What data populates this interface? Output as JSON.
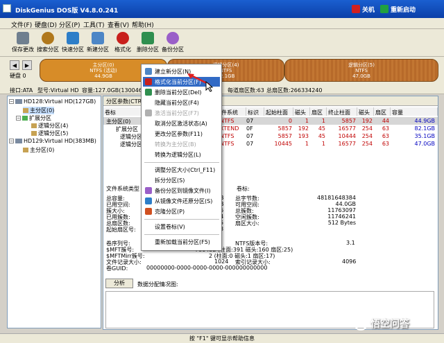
{
  "titlebar": {
    "title": "DiskGenius DOS版 V4.8.0.241",
    "shutdown": "关机",
    "restart": "重新启动"
  },
  "menubar": [
    "文件(F)",
    "硬盘(D)",
    "分区(P)",
    "工具(T)",
    "查看(V)",
    "帮助(H)"
  ],
  "toolbar": [
    {
      "label": "保存更改",
      "icon": "save-icon",
      "color": "#6f7f8f"
    },
    {
      "label": "搜索分区",
      "icon": "search-icon",
      "color": "#b0781c"
    },
    {
      "label": "快速分区",
      "icon": "quick-partition-icon",
      "color": "#2d7ec8"
    },
    {
      "label": "新建分区",
      "icon": "new-partition-icon",
      "color": "#4c86c6"
    },
    {
      "label": "格式化",
      "icon": "format-icon",
      "color": "#c8201c"
    },
    {
      "label": "删除分区",
      "icon": "delete-icon",
      "color": "#2f8f4f"
    },
    {
      "label": "备份分区",
      "icon": "backup-icon",
      "color": "#9a5fc8"
    }
  ],
  "diskbar": {
    "disk_label": "硬盘 0",
    "partitions": [
      {
        "name": "主分区(0)",
        "fs": "NTFS (活动)",
        "size": "44.9GB"
      },
      {
        "name": "逻辑分区(4)",
        "fs": "NTFS",
        "size": "82.1GB"
      },
      {
        "name": "逻辑分区(5)",
        "fs": "NTFS",
        "size": "47.0GB"
      }
    ]
  },
  "infoline": {
    "iface": "接口:ATA",
    "model": "型号:Virtual HD",
    "capacity": "容量:127.0GB(130046",
    "sectors_per_track": "每道扇区数:63",
    "total_sectors": "总扇区数:266334240"
  },
  "tree": [
    {
      "label": "HD128:Virtual HD(127GB)",
      "level": 0,
      "toggle": "-"
    },
    {
      "label": "主分区(0)",
      "level": 1,
      "selected": true
    },
    {
      "label": "扩展分区",
      "level": 1,
      "toggle": "-"
    },
    {
      "label": "逻辑分区(4)",
      "level": 2
    },
    {
      "label": "逻辑分区(5)",
      "level": 2
    },
    {
      "label": "HD129:Virtual HD(383MB)",
      "level": 0,
      "toggle": "-"
    },
    {
      "label": "主分区(0)",
      "level": 1
    }
  ],
  "panel": {
    "tab": "分区参数(CTRL",
    "col_name": "卷标",
    "headers": [
      "件系统",
      "标识",
      "起始柱面",
      "磁头",
      "扇区",
      "终止柱面",
      "磁头",
      "扇区",
      "容量"
    ],
    "rows": [
      {
        "name": "主分区(0)",
        "cells": [
          "NTFS",
          "07",
          "0",
          "1",
          "1",
          "5857",
          "192",
          "44",
          "44.9GB"
        ],
        "sel": true
      },
      {
        "name": "扩展分区",
        "cells": [
          "XTEND",
          "0F",
          "5857",
          "192",
          "45",
          "16577",
          "254",
          "63",
          "82.1GB"
        ]
      },
      {
        "name": "逻辑分区(4)",
        "cells": [
          "NTFS",
          "07",
          "5857",
          "193",
          "45",
          "10444",
          "254",
          "63",
          "35.1GB"
        ]
      },
      {
        "name": "逻辑分区(5)",
        "cells": [
          "NTFS",
          "07",
          "10445",
          "1",
          "1",
          "16577",
          "254",
          "63",
          "47.0GB"
        ]
      }
    ]
  },
  "info": {
    "fs_type_label": "文件系统类型",
    "volume_label": "卷标:",
    "left_labels": [
      "总容量:",
      "已用空间:",
      "簇大小:",
      "已用簇数:",
      "总扇区数:",
      "起始扇区号:"
    ],
    "left_vals": [
      "B",
      "B",
      "6",
      "4",
      "5",
      "3"
    ],
    "right_labels": [
      "总字节数:",
      "可用空间:",
      "总簇数:",
      "空闲簇数:",
      "扇区大小:"
    ],
    "right_vals": [
      "48181648384",
      "44.0GB",
      "11763097",
      "11746241",
      "512 Bytes"
    ],
    "volume_serial": "卷序列号:",
    "ntfs_version_label": "NTFS版本号:",
    "ntfs_version": "3.1",
    "mft_cluster": "$MFT簇号:",
    "mft_val": "786432 (柱面:391 磁头:160 扇区:25)",
    "mftmirr_cluster": "$MFTMirr簇号:",
    "mftmirr_val": "2 (柱面:0 磁头:1 扇区:17)",
    "file_record_size": "文件记录大小:",
    "file_record_val": "1024",
    "index_record_label": "索引记录大小:",
    "index_record_val": "4096",
    "guid_label": "卷GUID:",
    "guid_val": "00000000-0000-0000-0000-000000000000"
  },
  "analyze": {
    "button": "分析",
    "label": "数据分配情况图:"
  },
  "context_menu": [
    {
      "label": "建立新分区(N)",
      "icon": "new-partition-icon",
      "color": "#4c86c6"
    },
    {
      "label": "格式化当前分区(F)",
      "icon": "format-icon",
      "color": "#c8201c",
      "highlight": true
    },
    {
      "label": "删除当前分区(Del)",
      "icon": "delete-icon",
      "color": "#2f8f4f"
    },
    {
      "label": "隐藏当前分区(F4)",
      "icon": "",
      "color": ""
    },
    {
      "label": "激活当前分区(F7)",
      "icon": "activate-icon",
      "color": "#b0b0b0",
      "disabled": true
    },
    {
      "label": "取消分区激活状态(A)",
      "icon": "",
      "color": ""
    },
    {
      "label": "更改分区参数(F11)",
      "icon": "",
      "color": ""
    },
    {
      "label": "转换为主分区(B)",
      "icon": "",
      "color": "",
      "disabled": true
    },
    {
      "label": "转换为逻辑分区(L)",
      "icon": "",
      "color": ""
    },
    {
      "sep": true
    },
    {
      "label": "调整分区大小(Ctrl_F11)",
      "icon": "",
      "color": ""
    },
    {
      "label": "拆分分区(S)",
      "icon": "",
      "color": ""
    },
    {
      "label": "备份分区到镜像文件(I)",
      "icon": "backup-icon",
      "color": "#9a5fc8"
    },
    {
      "label": "从镜像文件还原分区(S)",
      "icon": "restore-icon",
      "color": "#2d7ec8"
    },
    {
      "label": "克隆分区(P)",
      "icon": "clone-icon",
      "color": "#d05020"
    },
    {
      "sep": true
    },
    {
      "label": "设置卷标(V)",
      "icon": "",
      "color": ""
    },
    {
      "sep": true
    },
    {
      "label": "重新加载当前分区(F5)",
      "icon": "",
      "color": ""
    }
  ],
  "statusbar": "按 \"F1\" 键可显示帮助信息",
  "watermark": "悟空问答"
}
